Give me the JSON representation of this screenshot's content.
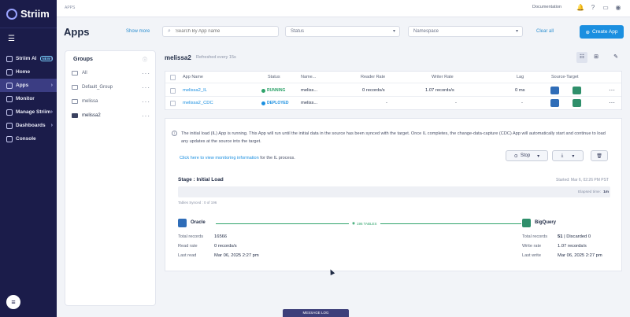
{
  "sidebar": {
    "brand": "Striim",
    "items": [
      {
        "label": "Striim AI",
        "badge": "NEW",
        "chevron": "›"
      },
      {
        "label": "Home",
        "chevron": ""
      },
      {
        "label": "Apps",
        "chevron": "›"
      },
      {
        "label": "Monitor",
        "chevron": ""
      },
      {
        "label": "Manage Striim",
        "chevron": "›"
      },
      {
        "label": "Dashboards",
        "chevron": "›"
      },
      {
        "label": "Console",
        "chevron": ""
      }
    ]
  },
  "topbar": {
    "breadcrumb": "APPS",
    "documentation": "Documentation"
  },
  "header": {
    "title": "Apps",
    "show_more": "Show more",
    "search_placeholder": "Search By App name",
    "status_dd": "Status",
    "namespace_dd": "Namespace",
    "clear_all": "Clear all",
    "create_app": "Create App"
  },
  "groups": {
    "title": "Groups",
    "items": [
      {
        "label": "All"
      },
      {
        "label": "Default_Group"
      },
      {
        "label": "melissa"
      },
      {
        "label": "melissa2"
      }
    ]
  },
  "list": {
    "title": "melissa2",
    "refresh": "Refreshed every 15s",
    "columns": [
      "App Name",
      "Status",
      "Name...",
      "Reader Rate",
      "Writer Rate",
      "Lag",
      "Source-Target"
    ],
    "rows": [
      {
        "name": "melissa2_IL",
        "status": "RUNNING",
        "status_color": "#2fa36b",
        "ns": "meliss...",
        "reader": "0 records/s",
        "writer": "1.07 records/s",
        "lag": "0 ms"
      },
      {
        "name": "melissa2_CDC",
        "status": "DEPLOYED",
        "status_color": "#1b8fe0",
        "ns": "meliss...",
        "reader": "-",
        "writer": "-",
        "lag": "-"
      }
    ]
  },
  "detail": {
    "info": "The initial load (IL) App is running. This App will run until the initial data in the source has been synced with the target. Once IL completes, the change-data-capture (CDC) App will automatically start and continue to load any updates at the source into the target.",
    "monitor_link": "Click here to view monitoring information",
    "monitor_suffix": " for the IL process.",
    "stop": "Stop",
    "stage": "Stage : Initial Load",
    "started": "Started: Mar 6, 02:26 PM PST",
    "elapsed_label": "Elapsed time:",
    "elapsed_value": "1m",
    "tables_synced": "Tables Synced : 0 of 196",
    "flow_label": "196 TABLES",
    "source": {
      "name": "Oracle",
      "color": "#2f6db8",
      "total_label": "Total records",
      "total": "16566",
      "rate_label": "Read rate",
      "rate": "0   records/s",
      "last_label": "Last read",
      "last": "Mar 06, 2025 2:27 pm"
    },
    "target": {
      "name": "BigQuery",
      "color": "#2f8f6b",
      "total_label": "Total records",
      "total": "51",
      "discarded": "Discarded 0",
      "rate_label": "Write rate",
      "rate": "1.07   records/s",
      "last_label": "Last write",
      "last": "Mar 06, 2025 2:27 pm"
    }
  },
  "message_log": "MESSAGE LOG",
  "colors": {
    "accent": "#1b8fe0",
    "sidebar": "#1b1c4a",
    "success": "#2fa36b"
  }
}
